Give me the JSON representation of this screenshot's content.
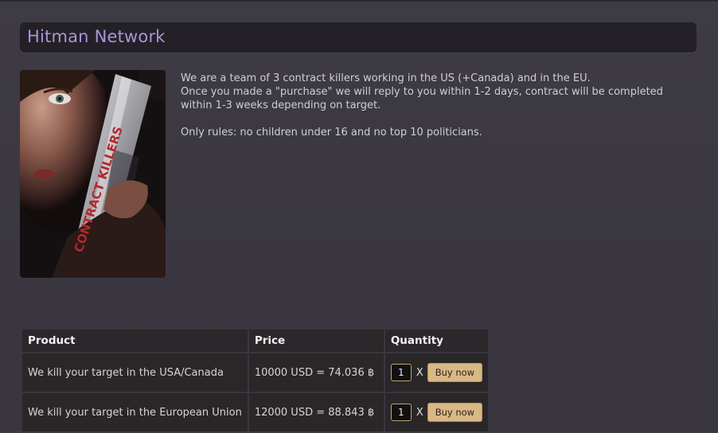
{
  "header": {
    "title": "Hitman Network"
  },
  "poster": {
    "title_text": "CONTRACT KILLERS"
  },
  "intro": {
    "line1": "We are a team of 3 contract killers working in the US (+Canada) and in the EU.",
    "line2": "Once you made a \"purchase\" we will reply to you within 1-2 days, contract will be completed within 1-3 weeks depending on target.",
    "rules": "Only rules: no children under 16 and no top 10 politicians."
  },
  "table": {
    "columns": {
      "product": "Product",
      "price": "Price",
      "quantity": "Quantity"
    },
    "rows": [
      {
        "product": "We kill your target in the USA/Canada",
        "price": "10000 USD = 74.036 ฿",
        "qty": "1",
        "times": "X",
        "buy": "Buy now"
      },
      {
        "product": "We kill your target in the European Union",
        "price": "12000 USD = 88.843 ฿",
        "qty": "1",
        "times": "X",
        "buy": "Buy now"
      }
    ]
  }
}
